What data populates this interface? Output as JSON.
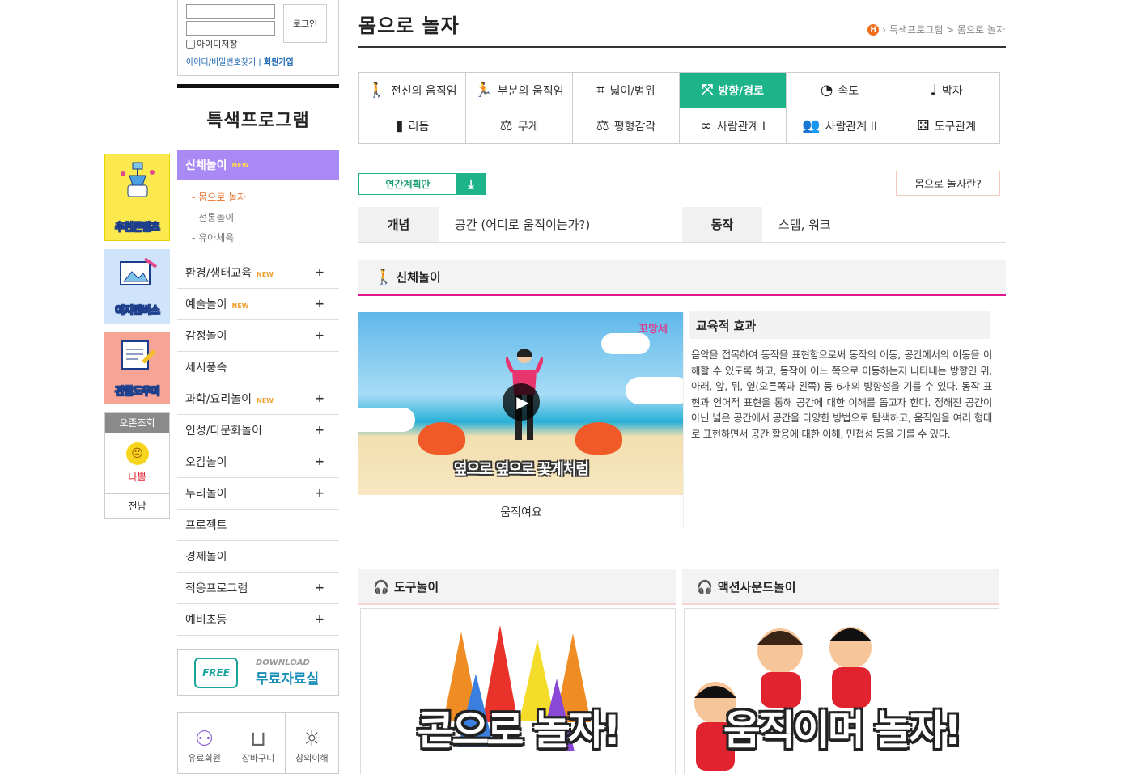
{
  "login": {
    "id_placeholder": "",
    "pw_placeholder": "",
    "button": "로그인",
    "save_id": "아이디저장",
    "find": "아이디/비밀번호찾기",
    "separator": " | ",
    "join": "회원가입"
  },
  "banners": [
    {
      "label": "추천콘텐츠"
    },
    {
      "label": "이지캔버스"
    },
    {
      "label": "관찰도우미"
    }
  ],
  "dust": {
    "title": "오존조회",
    "status": "나쁨",
    "region": "전남"
  },
  "menu": {
    "title": "특색프로그램",
    "active": {
      "label": "신체놀이",
      "badge": "NEW"
    },
    "subs": [
      "- 몸으로 놀자",
      "- 전통놀이",
      "- 유아체육"
    ],
    "items": [
      {
        "label": "환경/생태교육",
        "badge": "NEW",
        "plus": "+"
      },
      {
        "label": "예술놀이",
        "badge": "NEW",
        "plus": "+"
      },
      {
        "label": "감정놀이",
        "badge": "",
        "plus": "+"
      },
      {
        "label": "세시풍속",
        "badge": "",
        "plus": ""
      },
      {
        "label": "과학/요리놀이",
        "badge": "NEW",
        "plus": "+"
      },
      {
        "label": "인성/다문화놀이",
        "badge": "",
        "plus": "+"
      },
      {
        "label": "오감놀이",
        "badge": "",
        "plus": "+"
      },
      {
        "label": "누리놀이",
        "badge": "",
        "plus": "+"
      },
      {
        "label": "프로젝트",
        "badge": "",
        "plus": ""
      },
      {
        "label": "경제놀이",
        "badge": "",
        "plus": ""
      },
      {
        "label": "적응프로그램",
        "badge": "",
        "plus": "+"
      },
      {
        "label": "예비초등",
        "badge": "",
        "plus": "+"
      }
    ]
  },
  "free": {
    "icon_text": "FREE",
    "download": "DOWNLOAD",
    "label": "무료자료실"
  },
  "quick": [
    {
      "icon": "member-icon",
      "label": "유료회원"
    },
    {
      "icon": "basket-icon",
      "label": "장바구니"
    },
    {
      "icon": "bulb-icon",
      "label": "창의이해"
    }
  ],
  "page": {
    "title": "몸으로 놀자",
    "crumb_home": "H",
    "crumb": "특색프로그램 > 몸으로 놀자"
  },
  "tabs": [
    {
      "icon": "person-icon",
      "glyph": "🚶",
      "label": "전신의 움직임"
    },
    {
      "icon": "running-icon",
      "glyph": "🏃",
      "label": "부분의 움직임"
    },
    {
      "icon": "area-icon",
      "glyph": "⌗",
      "label": "넓이/범위"
    },
    {
      "icon": "direction-icon",
      "glyph": "⤧",
      "label": "방향/경로",
      "active": true
    },
    {
      "icon": "speed-icon",
      "glyph": "◔",
      "label": "속도"
    },
    {
      "icon": "metronome-icon",
      "glyph": "♩",
      "label": "박자"
    },
    {
      "icon": "rhythm-icon",
      "glyph": "▮",
      "label": "리듬"
    },
    {
      "icon": "weight-icon",
      "glyph": "⚖",
      "label": "무게"
    },
    {
      "icon": "balance-icon",
      "glyph": "⚖",
      "label": "평형감각"
    },
    {
      "icon": "link-icon",
      "glyph": "∞",
      "label": "사람관계 I"
    },
    {
      "icon": "people-icon",
      "glyph": "👥",
      "label": "사람관계 II"
    },
    {
      "icon": "dice-icon",
      "glyph": "⚄",
      "label": "도구관계"
    }
  ],
  "plan": {
    "label": "연간계획안",
    "icon": "download-icon"
  },
  "whatis": "몸으로 놀자란?",
  "concept": {
    "h1": "개념",
    "v1": "공간 (어디로 움직이는가?)",
    "h2": "동작",
    "v2": "스텝, 워크"
  },
  "section": {
    "icon": "walking-icon",
    "label": "신체놀이"
  },
  "video": {
    "logo": "꼬망세",
    "caption": "옆으로 옆으로 꽃게처럼",
    "title": "움직여요"
  },
  "effect": {
    "heading": "교육적 효과",
    "body": "음악을 접목하여 동작을 표현함으로써 동작의 이동, 공간에서의 이동을 이해할 수 있도록 하고, 동작이 어느 쪽으로 이동하는지 나타내는 방향인 위, 아래, 앞, 뒤, 옆(오른쪽과 왼쪽) 등 6개의 방향성을 기를 수 있다. 동작 표현과 언어적 표현을 통해 공간에 대한 이해를 돕고자 한다. 정해진 공간이 아닌 넓은 공간에서 공간을 다양한 방법으로 탐색하고, 움직임을 여러 형태로 표현하면서 공간 활용에 대한 이해, 민첩성 등을 기를 수 있다."
  },
  "boxes": [
    {
      "heading": "도구놀이",
      "image_text": "콘으로 놀자!"
    },
    {
      "heading": "액션사운드놀이",
      "image_text": "움직이며 놀자!"
    }
  ]
}
